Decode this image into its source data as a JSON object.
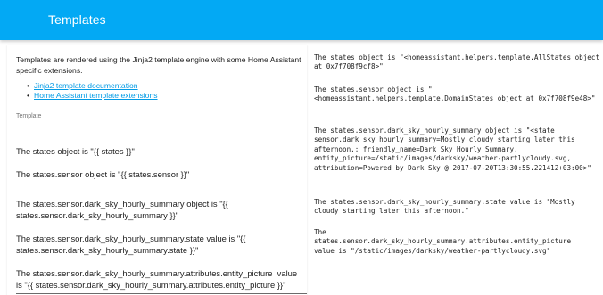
{
  "header": {
    "title": "Templates"
  },
  "intro": {
    "text": "Templates are rendered using the Jinja2 template engine with some Home Assistant specific extensions."
  },
  "links": [
    {
      "label": "Jinja2 template documentation"
    },
    {
      "label": "Home Assistant template extensions"
    }
  ],
  "editor": {
    "label": "Template",
    "lines": [
      "The states object is \"{{ states }}\"",
      "The states.sensor object is \"{{ states.sensor }}\"",
      "The states.sensor.dark_sky_hourly_summary object is \"{{ states.sensor.dark_sky_hourly_summary }}\"",
      "The states.sensor.dark_sky_hourly_summary.state value is \"{{ states.sensor.dark_sky_hourly_summary.state }}\"",
      "The states.sensor.dark_sky_hourly_summary.attributes.entity_picture  value is \"{{ states.sensor.dark_sky_hourly_summary.attributes.entity_picture }}\""
    ]
  },
  "output": {
    "blocks": [
      "The states object is \"<homeassistant.helpers.template.AllStates object at 0x7f708f9cf8>\"",
      "The states.sensor object is \"\n<homeassistant.helpers.template.DomainStates object at 0x7f708f9e48>\"",
      "The states.sensor.dark_sky_hourly_summary object is \"<state sensor.dark_sky_hourly_summary=Mostly cloudy starting later this afternoon.; friendly_name=Dark Sky Hourly Summary, entity_picture=/static/images/darksky/weather-partlycloudy.svg, attribution=Powered by Dark Sky @ 2017-07-20T13:30:55.221412+03:00>\"",
      "The states.sensor.dark_sky_hourly_summary.state value is \"Mostly cloudy starting later this afternoon.\"",
      "The\nstates.sensor.dark_sky_hourly_summary.attributes.entity_picture\nvalue is \"/static/images/darksky/weather-partlycloudy.svg\""
    ]
  }
}
